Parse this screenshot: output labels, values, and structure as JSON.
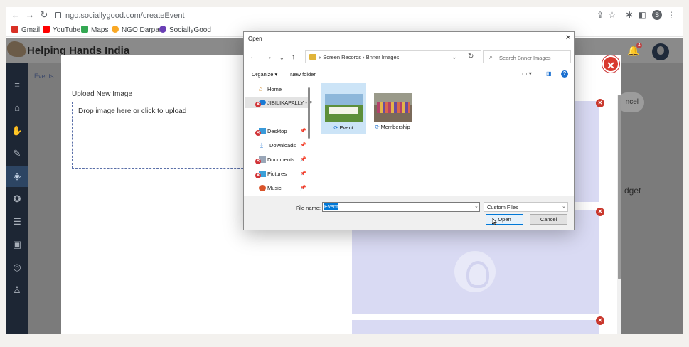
{
  "browser": {
    "url": "ngo.sociallygood.com/createEvent",
    "profile_initial": "S",
    "bookmarks": [
      {
        "label": "Gmail",
        "color": "#d93025"
      },
      {
        "label": "YouTube",
        "color": "#ff0000"
      },
      {
        "label": "Maps",
        "color": "#34a853"
      },
      {
        "label": "NGO Darpan",
        "color": "#f9a825"
      },
      {
        "label": "SociallyGood",
        "color": "#6a3fb5"
      }
    ]
  },
  "site": {
    "name": "Helping Hands India",
    "breadcrumb": "Events",
    "notification_count": "4",
    "cancel_label": "ncel",
    "budget_label": "dget"
  },
  "upload_modal": {
    "title": "Upload New Image",
    "dropzone_text": "Drop image here or click to upload",
    "close_icon": "close-icon"
  },
  "file_dialog": {
    "title": "Open",
    "path_text": "« Screen Records  ›  Bnner Images",
    "search_placeholder": "Search Bnner Images",
    "organize_label": "Organize ▾",
    "new_folder_label": "New folder",
    "nav_items": [
      {
        "label": "Home",
        "icon": "home-icon"
      },
      {
        "label": "JIBILIKAPALLY - P",
        "icon": "onedrive-icon",
        "error": true
      },
      {
        "label": "Desktop",
        "icon": "desktop-icon",
        "pinned": true,
        "error": true
      },
      {
        "label": "Downloads",
        "icon": "downloads-icon",
        "pinned": true
      },
      {
        "label": "Documents",
        "icon": "documents-icon",
        "pinned": true,
        "error": true
      },
      {
        "label": "Pictures",
        "icon": "pictures-icon",
        "pinned": true,
        "error": true
      },
      {
        "label": "Music",
        "icon": "music-icon",
        "pinned": true
      }
    ],
    "files": [
      {
        "name": "Event",
        "selected": true
      },
      {
        "name": "Membership",
        "selected": false
      }
    ],
    "file_name_label": "File name:",
    "file_name_value": "Event",
    "file_type": "Custom Files",
    "open_label": "Open",
    "cancel_label": "Cancel"
  },
  "colors": {
    "sidebar_bg": "#1d2634",
    "preview_bg": "#d9daf3",
    "remove_red": "#c9372c",
    "selection_blue": "#0078d7"
  }
}
